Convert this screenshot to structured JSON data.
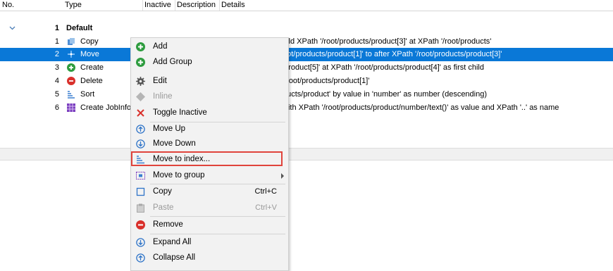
{
  "header": {
    "no": "No.",
    "type": "Type",
    "inactive": "Inactive",
    "description": "Description",
    "details": "Details"
  },
  "group": {
    "number": "1",
    "label": "Default"
  },
  "rows": [
    {
      "no": "1",
      "type": "Copy",
      "details": "hild XPath '/root/products/product[3]' at XPath '/root/products'"
    },
    {
      "no": "2",
      "type": "Move",
      "details": "oot/products/product[1]' to after XPath '/root/products/product[3]'"
    },
    {
      "no": "3",
      "type": "Create",
      "details": "'product[5]' at XPath '/root/products/product[4]' as first child"
    },
    {
      "no": "4",
      "type": "Delete",
      "details": "'/root/products/product[1]'"
    },
    {
      "no": "5",
      "type": "Sort",
      "details": "ducts/product' by value in 'number' as number (descending)"
    },
    {
      "no": "6",
      "type": "Create JobInfos",
      "details": "with XPath '/root/products/product/number/text()' as value and XPath '..' as name"
    }
  ],
  "menu": {
    "add": "Add",
    "add_group": "Add Group",
    "edit": "Edit",
    "inline": "Inline",
    "toggle_inactive": "Toggle Inactive",
    "move_up": "Move Up",
    "move_down": "Move Down",
    "move_to_index": "Move to index...",
    "move_to_group": "Move to group",
    "copy": "Copy",
    "copy_shortcut": "Ctrl+C",
    "paste": "Paste",
    "paste_shortcut": "Ctrl+V",
    "remove": "Remove",
    "expand_all": "Expand All",
    "collapse_all": "Collapse All"
  },
  "colors": {
    "selection": "#0a78d7",
    "highlight_box": "#e0443c",
    "green": "#2e9c3f",
    "red": "#d9302b"
  }
}
